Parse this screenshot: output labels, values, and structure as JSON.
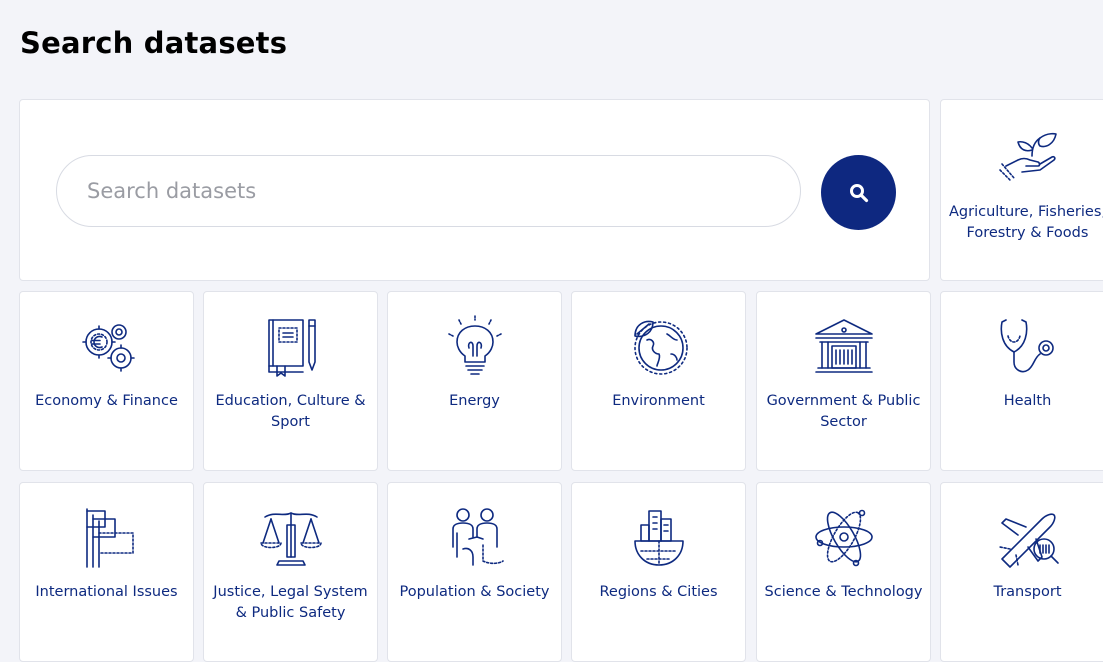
{
  "page": {
    "title": "Search datasets"
  },
  "search": {
    "placeholder": "Search datasets"
  },
  "colors": {
    "primary": "#0e2880",
    "background": "#f3f4f9",
    "card": "#ffffff",
    "border": "#e1e3ea"
  },
  "categories": [
    {
      "label": "Agriculture, Fisheries, Forestry & Foods",
      "icon": "plant-hand-icon"
    },
    {
      "label": "Economy & Finance",
      "icon": "euro-gears-icon"
    },
    {
      "label": "Education, Culture & Sport",
      "icon": "book-pen-icon"
    },
    {
      "label": "Energy",
      "icon": "lightbulb-icon"
    },
    {
      "label": "Environment",
      "icon": "globe-leaf-icon"
    },
    {
      "label": "Government & Public Sector",
      "icon": "government-building-icon"
    },
    {
      "label": "Health",
      "icon": "stethoscope-icon"
    },
    {
      "label": "International Issues",
      "icon": "flags-icon"
    },
    {
      "label": "Justice, Legal System & Public Safety",
      "icon": "scales-icon"
    },
    {
      "label": "Population & Society",
      "icon": "people-icon"
    },
    {
      "label": "Regions & Cities",
      "icon": "city-globe-icon"
    },
    {
      "label": "Science & Technology",
      "icon": "atom-icon"
    },
    {
      "label": "Transport",
      "icon": "airplane-icon"
    }
  ]
}
